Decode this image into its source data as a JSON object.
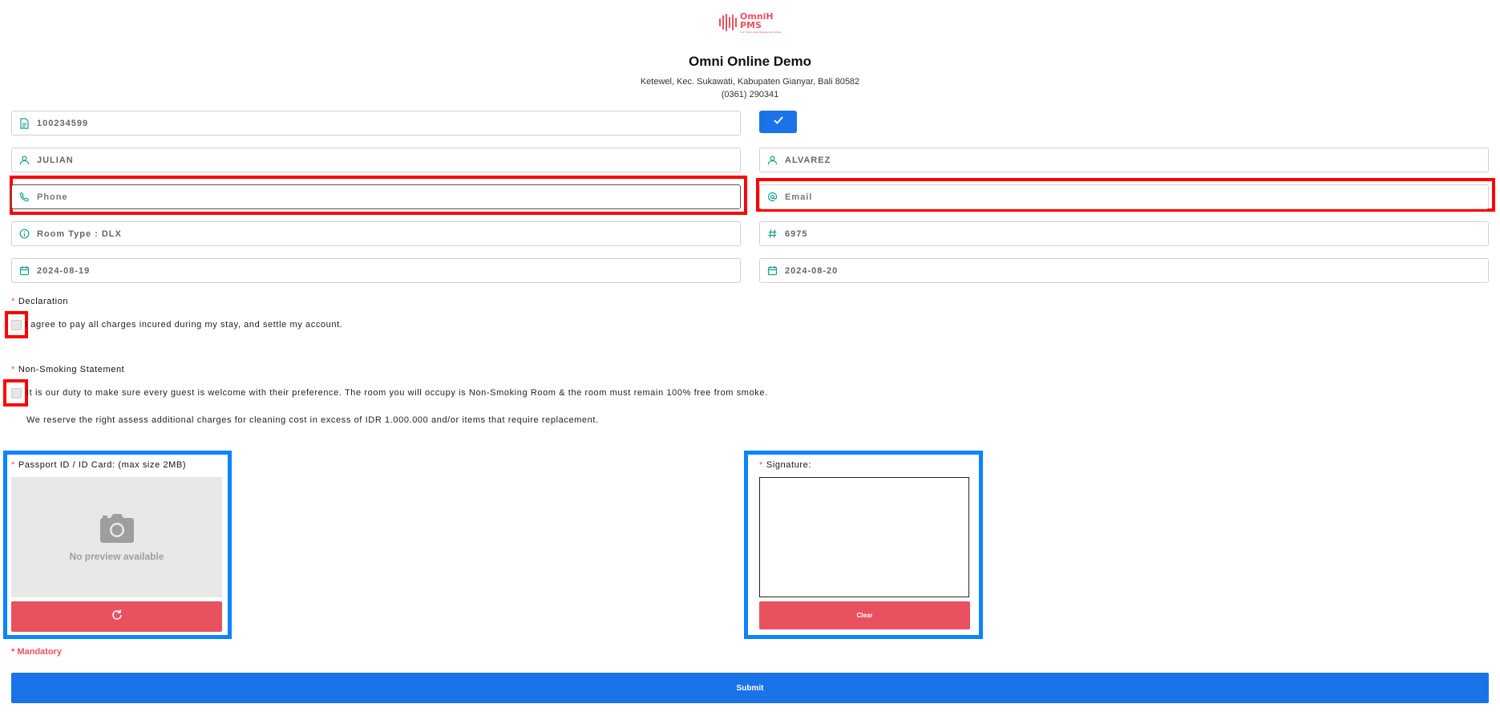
{
  "header": {
    "logo_text": "OmniH PMS",
    "logo_tagline": "Your Smart Hotel Management System",
    "hotel_name": "Omni Online Demo",
    "address": "Ketewel, Kec. Sukawati, Kabupaten Gianyar, Bali 80582",
    "phone": "(0361) 290341"
  },
  "form": {
    "booking_number": {
      "value": "100234599",
      "icon": "document-icon"
    },
    "first_name": {
      "value": "JULIAN",
      "icon": "user-icon"
    },
    "last_name": {
      "value": "ALVAREZ",
      "icon": "user-icon"
    },
    "phone": {
      "value": "",
      "placeholder": "Phone",
      "icon": "phone-icon"
    },
    "email": {
      "value": "",
      "placeholder": "Email",
      "icon": "at-icon"
    },
    "room_type": {
      "value": "Room Type : DLX",
      "icon": "info-icon"
    },
    "room_number": {
      "value": "6975",
      "icon": "hash-icon"
    },
    "arrival_date": {
      "value": "2024-08-19",
      "icon": "calendar-icon"
    },
    "departure_date": {
      "value": "2024-08-20",
      "icon": "calendar-icon"
    }
  },
  "declaration": {
    "required_mark": "*",
    "title": "Declaration",
    "text": "I agree to pay all charges incured during my stay, and settle my account."
  },
  "non_smoking": {
    "required_mark": "*",
    "title": "Non-Smoking Statement",
    "text": "It is our duty to make sure every guest is welcome with their preference. The room you will occupy is Non-Smoking Room & the room must remain 100% free from smoke.",
    "text2": "We reserve the right assess additional charges for cleaning cost in excess of IDR 1.000.000 and/or items that require replacement."
  },
  "passport": {
    "required_mark": "*",
    "label": "Passport ID / ID Card: (max size 2MB)",
    "preview_text": "No preview available"
  },
  "signature": {
    "required_mark": "*",
    "label": "Signature:",
    "clear_label": "Clear"
  },
  "mandatory_note": "* Mandatory",
  "submit_label": "Submit",
  "colors": {
    "primary": "#1a73e8",
    "danger": "#e8525f",
    "icon": "#1a9e8e",
    "highlight_red": "#ff0000",
    "highlight_blue": "#0a84ff"
  }
}
